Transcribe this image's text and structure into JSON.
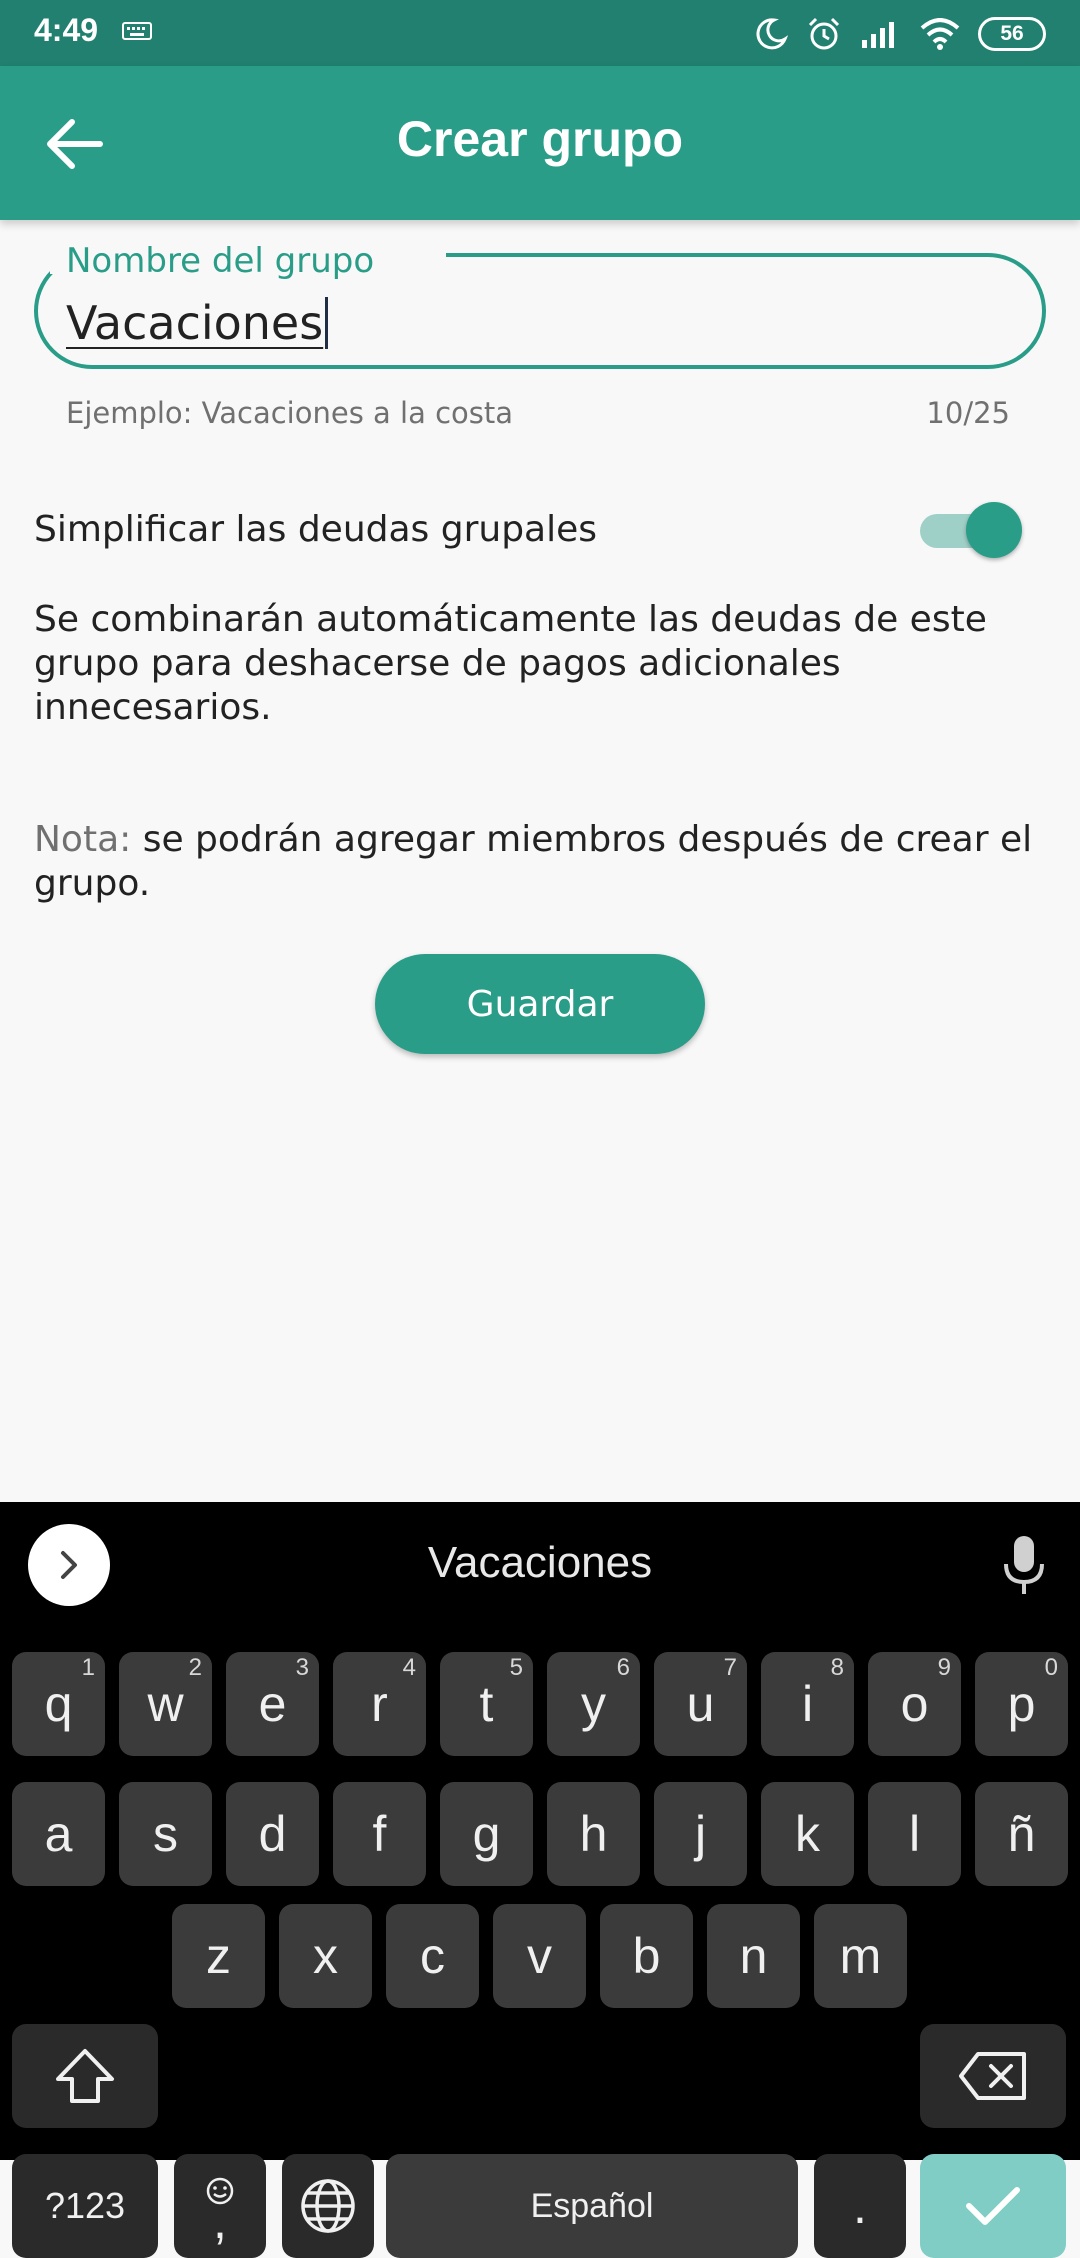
{
  "status_bar": {
    "time": "4:49",
    "battery": "56"
  },
  "app_bar": {
    "title": "Crear grupo"
  },
  "group_name_field": {
    "label": "Nombre del grupo",
    "value": "Vacaciones",
    "helper": "Ejemplo: Vacaciones a la costa",
    "counter": "10/25"
  },
  "simplify_setting": {
    "label": "Simplificar las deudas grupales",
    "enabled": true,
    "description": "Se combinarán automáticamente las deudas de este grupo para deshacerse de pagos adicionales innecesarios."
  },
  "note": {
    "prefix": "Nota:",
    "text": " se podrán agregar miembros después de crear el grupo."
  },
  "save_button": {
    "label": "Guardar"
  },
  "keyboard": {
    "suggestion": "Vacaciones",
    "row1": [
      {
        "key": "q",
        "hint": "1"
      },
      {
        "key": "w",
        "hint": "2"
      },
      {
        "key": "e",
        "hint": "3"
      },
      {
        "key": "r",
        "hint": "4"
      },
      {
        "key": "t",
        "hint": "5"
      },
      {
        "key": "y",
        "hint": "6"
      },
      {
        "key": "u",
        "hint": "7"
      },
      {
        "key": "i",
        "hint": "8"
      },
      {
        "key": "o",
        "hint": "9"
      },
      {
        "key": "p",
        "hint": "0"
      }
    ],
    "row2": [
      "a",
      "s",
      "d",
      "f",
      "g",
      "h",
      "j",
      "k",
      "l",
      "ñ"
    ],
    "row3": [
      "z",
      "x",
      "c",
      "v",
      "b",
      "n",
      "m"
    ],
    "symbols_key": "?123",
    "comma_key": ",",
    "space_key": "Español",
    "period_key": "."
  },
  "colors": {
    "primary": "#2a9d89",
    "status_bar": "#21806f",
    "toggle_track": "#9fd0c7",
    "enter_key": "#7fcdc4"
  }
}
